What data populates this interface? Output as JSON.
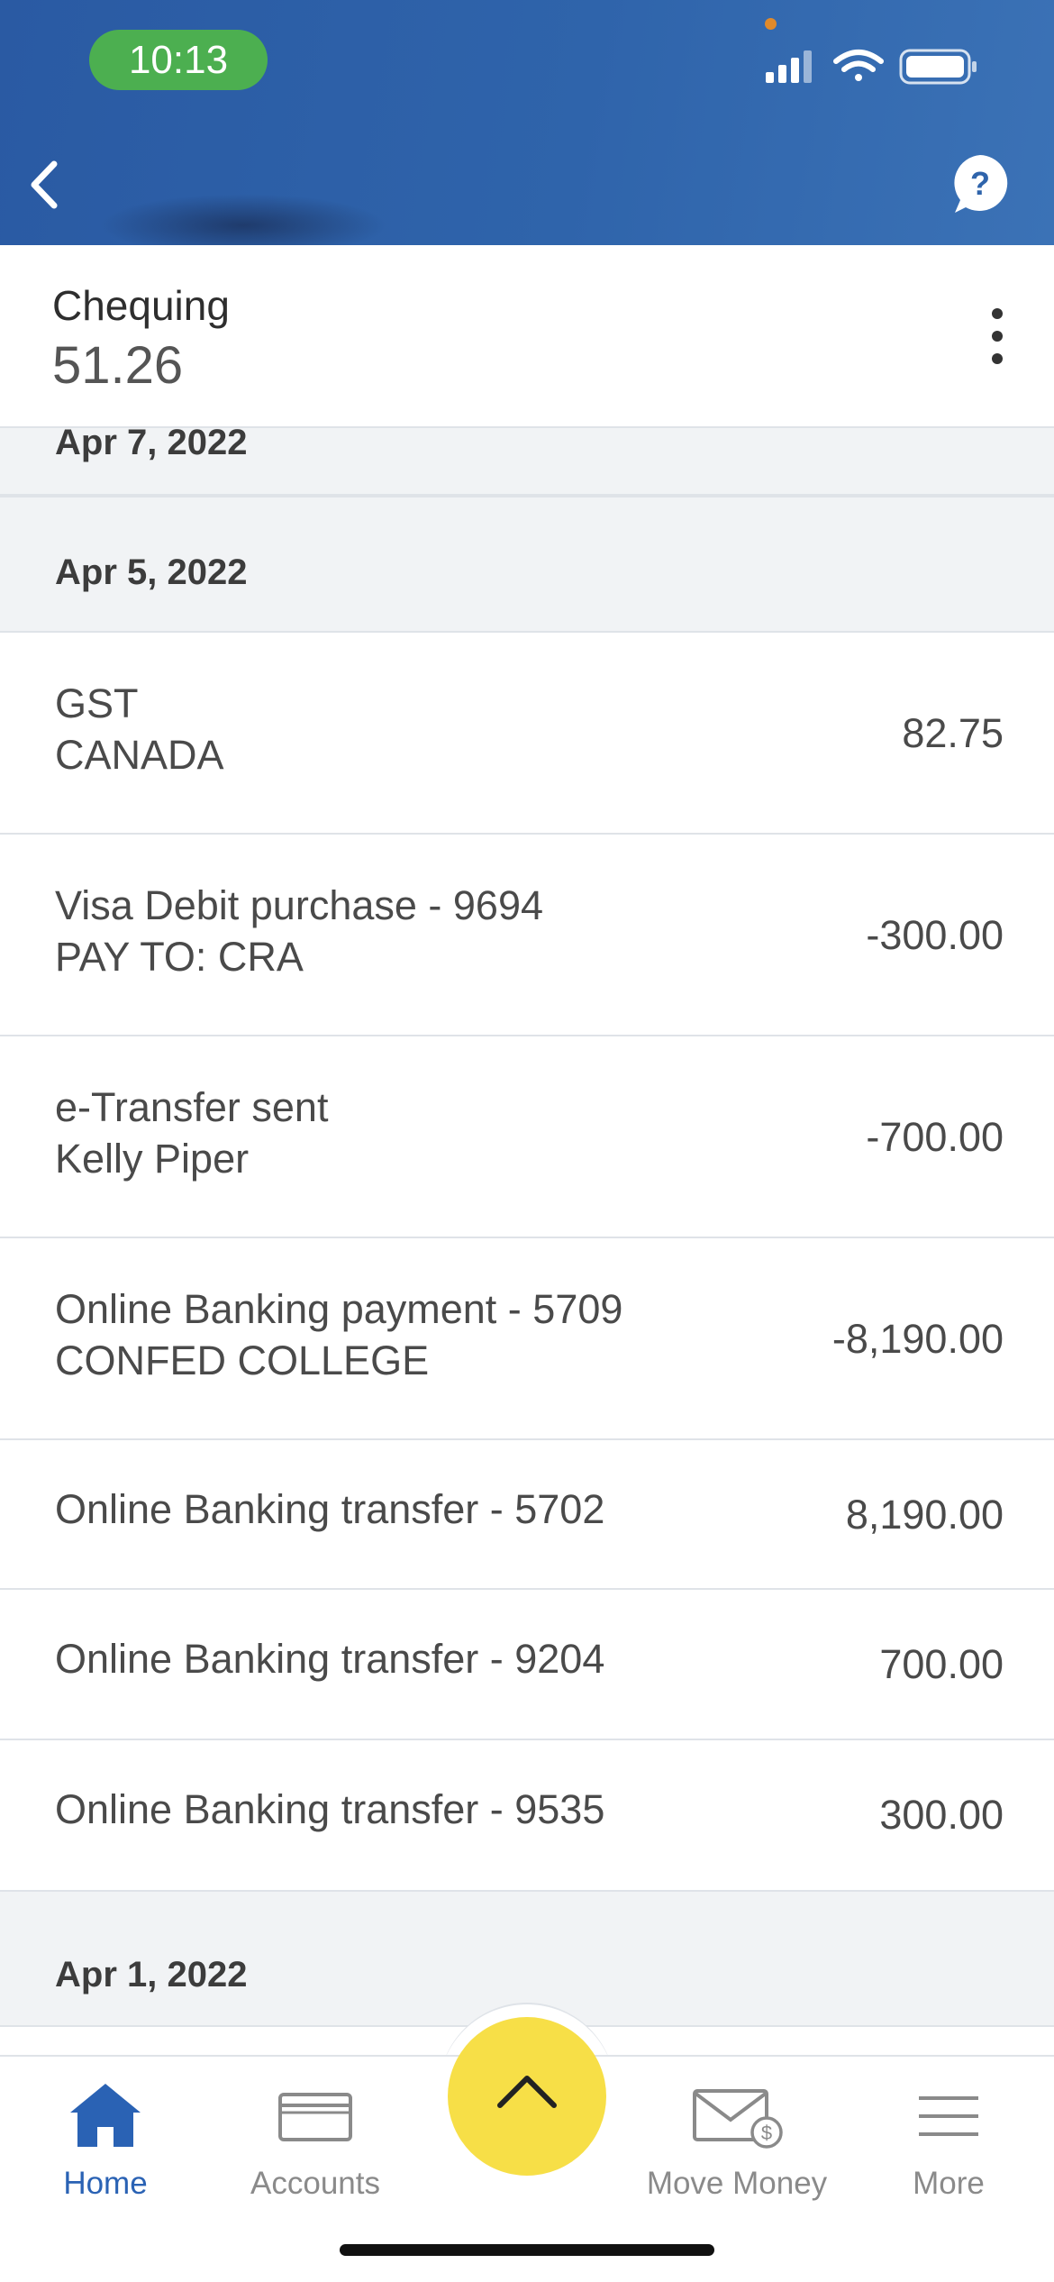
{
  "status_bar": {
    "time": "10:13"
  },
  "account": {
    "name": "Chequing",
    "balance": "51.26"
  },
  "date_groups": [
    {
      "date": "Apr 7, 2022"
    },
    {
      "date": "Apr 5, 2022"
    },
    {
      "date": "Apr 1, 2022"
    }
  ],
  "transactions": [
    {
      "line1": "GST",
      "line2": "CANADA",
      "amount": "82.75"
    },
    {
      "line1": "Visa Debit purchase - 9694",
      "line2": "PAY TO: CRA",
      "amount": "-300.00"
    },
    {
      "line1": "e-Transfer sent",
      "line2": "Kelly Piper",
      "amount": "-700.00"
    },
    {
      "line1": "Online Banking payment - 5709",
      "line2": "CONFED COLLEGE",
      "amount": "-8,190.00"
    },
    {
      "line1": "Online Banking transfer - 5702",
      "line2": "",
      "amount": "8,190.00"
    },
    {
      "line1": "Online Banking transfer - 9204",
      "line2": "",
      "amount": "700.00"
    },
    {
      "line1": "Online Banking transfer - 9535",
      "line2": "",
      "amount": "300.00"
    }
  ],
  "bottom_nav": {
    "items": [
      {
        "label": "Home",
        "icon": "home-icon"
      },
      {
        "label": "Accounts",
        "icon": "card-icon"
      },
      {
        "label": "Move Money",
        "icon": "envelope-dollar-icon"
      },
      {
        "label": "More",
        "icon": "menu-icon"
      }
    ]
  },
  "colors": {
    "header": "#2f64ab",
    "accent": "#2a62b4",
    "fab": "#f7df47",
    "time_pill": "#4caf50"
  }
}
